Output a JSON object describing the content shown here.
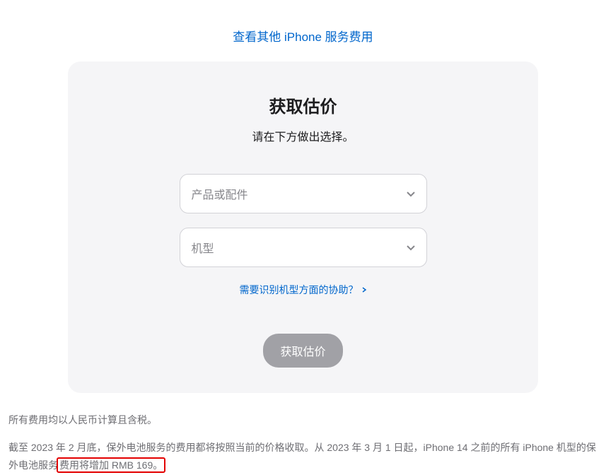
{
  "topLink": {
    "label": "查看其他 iPhone 服务费用"
  },
  "card": {
    "title": "获取估价",
    "subtitle": "请在下方做出选择。",
    "select1": {
      "placeholder": "产品或配件"
    },
    "select2": {
      "placeholder": "机型"
    },
    "helpLink": {
      "label": "需要识别机型方面的协助？"
    },
    "submitButton": {
      "label": "获取估价"
    }
  },
  "footer": {
    "line1": "所有费用均以人民币计算且含税。",
    "line2_part1": "截至 2023 年 2 月底，保外电池服务的费用都将按照当前的价格收取。从 2023 年 3 月 1 日起，iPhone 14 之前的所有 iPhone 机型的保外电池服务",
    "line2_highlight": "费用将增加 RMB 169。"
  }
}
